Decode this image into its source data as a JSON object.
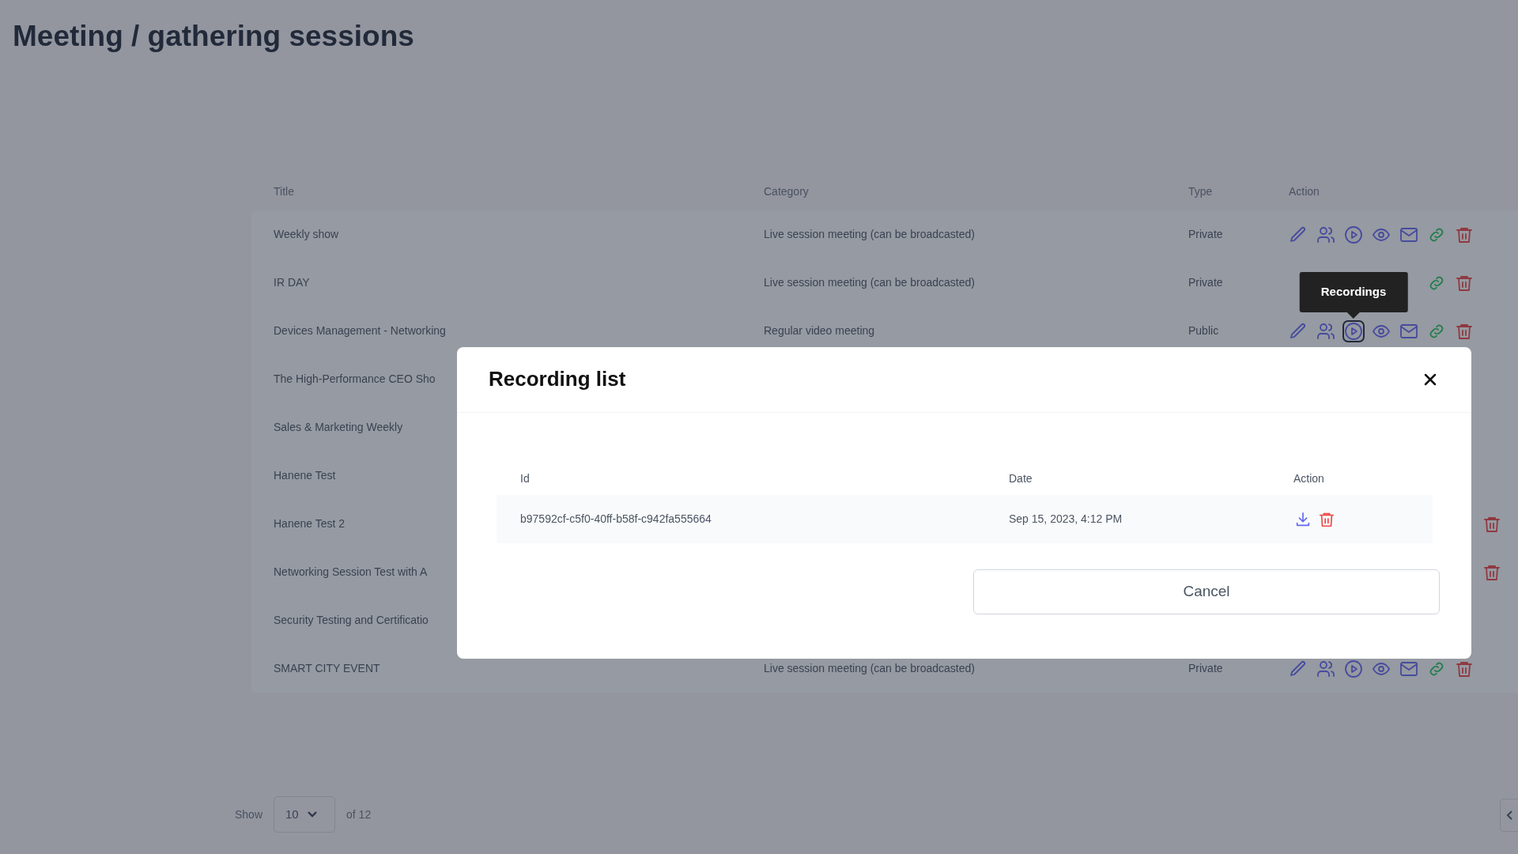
{
  "page": {
    "title": "Meeting / gathering sessions"
  },
  "table": {
    "columns": [
      "Title",
      "Category",
      "Type",
      "Action"
    ],
    "rows": [
      {
        "title": "Weekly show",
        "category": "Live session meeting (can be broadcasted)",
        "type": "Private",
        "kind": "full"
      },
      {
        "title": "IR DAY",
        "category": "Live session meeting (can be broadcasted)",
        "type": "Private",
        "kind": "partial"
      },
      {
        "title": "Devices Management - Networking",
        "category": "Regular video meeting",
        "type": "Public",
        "kind": "full",
        "tooltip": "Recordings"
      },
      {
        "title": "The High-Performance CEO Sho",
        "kind": "hidden"
      },
      {
        "title": "Sales & Marketing Weekly",
        "kind": "hidden"
      },
      {
        "title": "Hanene Test",
        "kind": "hidden"
      },
      {
        "title": "Hanene Test 2",
        "kind": "trash_only"
      },
      {
        "title": "Networking Session Test with A",
        "kind": "trash_only"
      },
      {
        "title": "Security Testing and Certificatio",
        "kind": "hidden"
      },
      {
        "title": "SMART CITY EVENT",
        "category": "Live session meeting (can be broadcasted)",
        "type": "Private",
        "kind": "full"
      }
    ]
  },
  "pagination": {
    "show_label": "Show",
    "page_size": "10",
    "of_label": "of 12"
  },
  "modal": {
    "title": "Recording list",
    "columns": [
      "Id",
      "Date",
      "Action"
    ],
    "rows": [
      {
        "id": "b97592cf-c5f0-40ff-b58f-c942fa555664",
        "date": "Sep 15, 2023, 4:12 PM"
      }
    ],
    "cancel": "Cancel"
  }
}
